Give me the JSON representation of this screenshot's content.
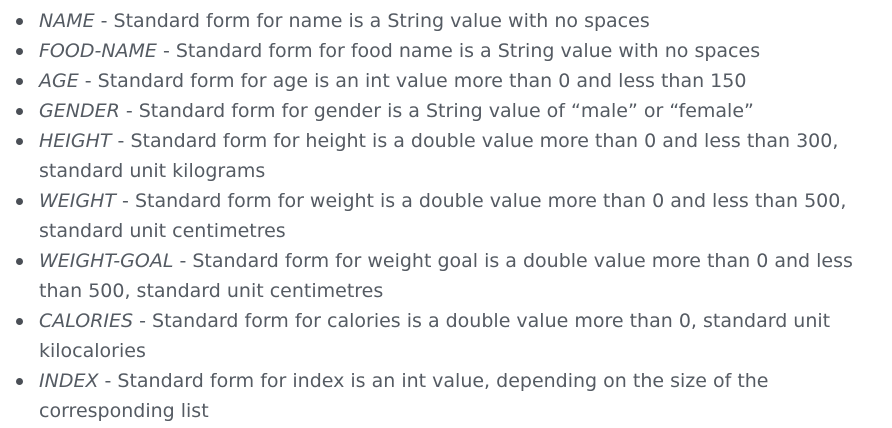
{
  "items": [
    {
      "term": "NAME",
      "sep": " - ",
      "desc": "Standard form for name is a String value with no spaces"
    },
    {
      "term": "FOOD-NAME",
      "sep": " - ",
      "desc": "Standard form for food name is a String value with no spaces"
    },
    {
      "term": "AGE",
      "sep": " - ",
      "desc": "Standard form for age is an int value more than 0 and less than 150"
    },
    {
      "term": "GENDER",
      "sep": " - ",
      "desc": "Standard form for gender is a String value of “male” or “female”"
    },
    {
      "term": "HEIGHT",
      "sep": " - ",
      "desc": "Standard form for height is a double value more than 0 and less than 300, standard unit kilograms"
    },
    {
      "term": "WEIGHT",
      "sep": " - ",
      "desc": "Standard form for weight is a double value more than 0 and less than 500, standard unit centimetres"
    },
    {
      "term": "WEIGHT-GOAL",
      "sep": " - ",
      "desc": "Standard form for weight goal is a double value more than 0 and less than 500, standard unit centimetres"
    },
    {
      "term": "CALORIES",
      "sep": " - ",
      "desc": "Standard form for calories is a double value more than 0, standard unit kilocalories"
    },
    {
      "term": "INDEX",
      "sep": " - ",
      "desc": "Standard form for index is an int value, depending on the size of the corresponding list"
    }
  ]
}
